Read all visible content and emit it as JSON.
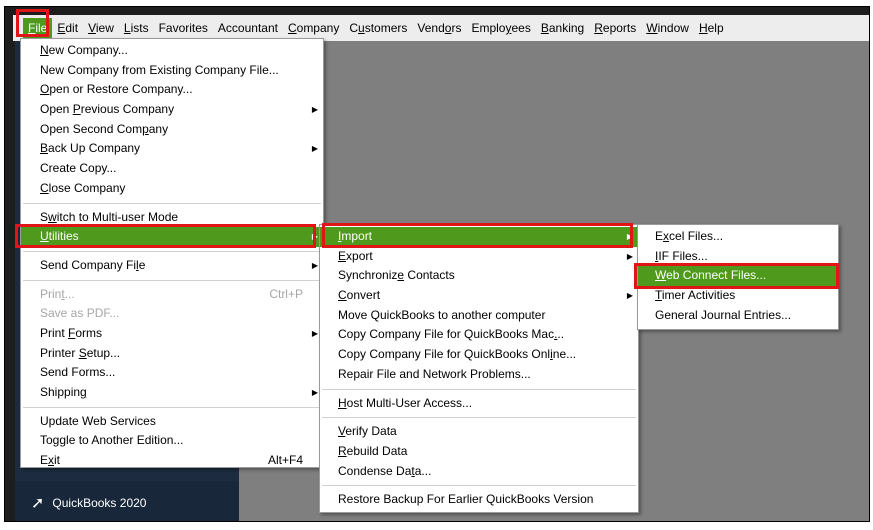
{
  "menubar": [
    {
      "label": "File",
      "u": 0,
      "active": true
    },
    {
      "label": "Edit",
      "u": 0
    },
    {
      "label": "View",
      "u": 0
    },
    {
      "label": "Lists",
      "u": 0
    },
    {
      "label": "Favorites",
      "u": -1
    },
    {
      "label": "Accountant",
      "u": -1
    },
    {
      "label": "Company",
      "u": 0
    },
    {
      "label": "Customers",
      "u": 1
    },
    {
      "label": "Vendors",
      "u": 4
    },
    {
      "label": "Employees",
      "u": 5
    },
    {
      "label": "Banking",
      "u": 0
    },
    {
      "label": "Reports",
      "u": 0
    },
    {
      "label": "Window",
      "u": 0
    },
    {
      "label": "Help",
      "u": 0
    }
  ],
  "file_menu": [
    {
      "label": "New Company...",
      "u": 0
    },
    {
      "label": "New Company from Existing Company File...",
      "u": -1
    },
    {
      "label": "Open or Restore Company...",
      "u": 0
    },
    {
      "label": "Open Previous Company",
      "u": 5,
      "submenu": true
    },
    {
      "label": "Open Second Company",
      "u": 15
    },
    {
      "label": "Back Up Company",
      "u": 0,
      "submenu": true
    },
    {
      "label": "Create Copy...",
      "u": -1
    },
    {
      "label": "Close Company",
      "u": 0
    },
    {
      "sep": true
    },
    {
      "label": "Switch to Multi-user Mode",
      "u": 1
    },
    {
      "label": "Utilities",
      "u": 0,
      "submenu": true,
      "highlighted": true
    },
    {
      "sep": true
    },
    {
      "label": "Send Company File",
      "u": 15,
      "submenu": true
    },
    {
      "sep": true
    },
    {
      "label": "Print...",
      "u": 4,
      "disabled": true,
      "shortcut": "Ctrl+P"
    },
    {
      "label": "Save as PDF...",
      "u": -1,
      "disabled": true
    },
    {
      "label": "Print Forms",
      "u": 6,
      "submenu": true
    },
    {
      "label": "Printer Setup...",
      "u": 8
    },
    {
      "label": "Send Forms...",
      "u": -1
    },
    {
      "label": "Shipping",
      "u": 7,
      "submenu": true
    },
    {
      "sep": true
    },
    {
      "label": "Update Web Services",
      "u": -1
    },
    {
      "label": "Toggle to Another Edition...",
      "u": -1
    },
    {
      "label": "Exit",
      "u": 1,
      "shortcut": "Alt+F4"
    }
  ],
  "utilities_menu": [
    {
      "label": "Import",
      "u": 0,
      "submenu": true,
      "highlighted": true
    },
    {
      "label": "Export",
      "u": 0,
      "submenu": true
    },
    {
      "label": "Synchronize Contacts",
      "u": 10
    },
    {
      "label": "Convert",
      "u": 0,
      "submenu": true
    },
    {
      "label": "Move QuickBooks to another computer",
      "u": -1
    },
    {
      "label": "Copy Company File for QuickBooks Mac...",
      "u": 36
    },
    {
      "label": "Copy Company File for QuickBooks Online...",
      "u": 36
    },
    {
      "label": "Repair File and Network Problems...",
      "u": -1
    },
    {
      "sep": true
    },
    {
      "label": "Host Multi-User Access...",
      "u": 0
    },
    {
      "sep": true
    },
    {
      "label": "Verify Data",
      "u": 0
    },
    {
      "label": "Rebuild Data",
      "u": 0
    },
    {
      "label": "Condense Data...",
      "u": 11
    },
    {
      "sep": true
    },
    {
      "label": "Restore Backup For Earlier QuickBooks Version",
      "u": -1
    }
  ],
  "import_menu": [
    {
      "label": "Excel Files...",
      "u": 1
    },
    {
      "label": "IIF Files...",
      "u": 0
    },
    {
      "label": "Web Connect Files...",
      "u": 0,
      "highlighted": true
    },
    {
      "label": "Timer Activities",
      "u": 0
    },
    {
      "label": "General Journal Entries...",
      "u": -1
    }
  ],
  "sidebar": {
    "footer_label": "QuickBooks 2020",
    "footer_icon": "quickbooks-arrow-icon"
  },
  "colors": {
    "highlight": "#4f9a1d",
    "annotation": "#e01515",
    "workspace": "#7f7f7f",
    "sidebar": "#1c2b40"
  }
}
